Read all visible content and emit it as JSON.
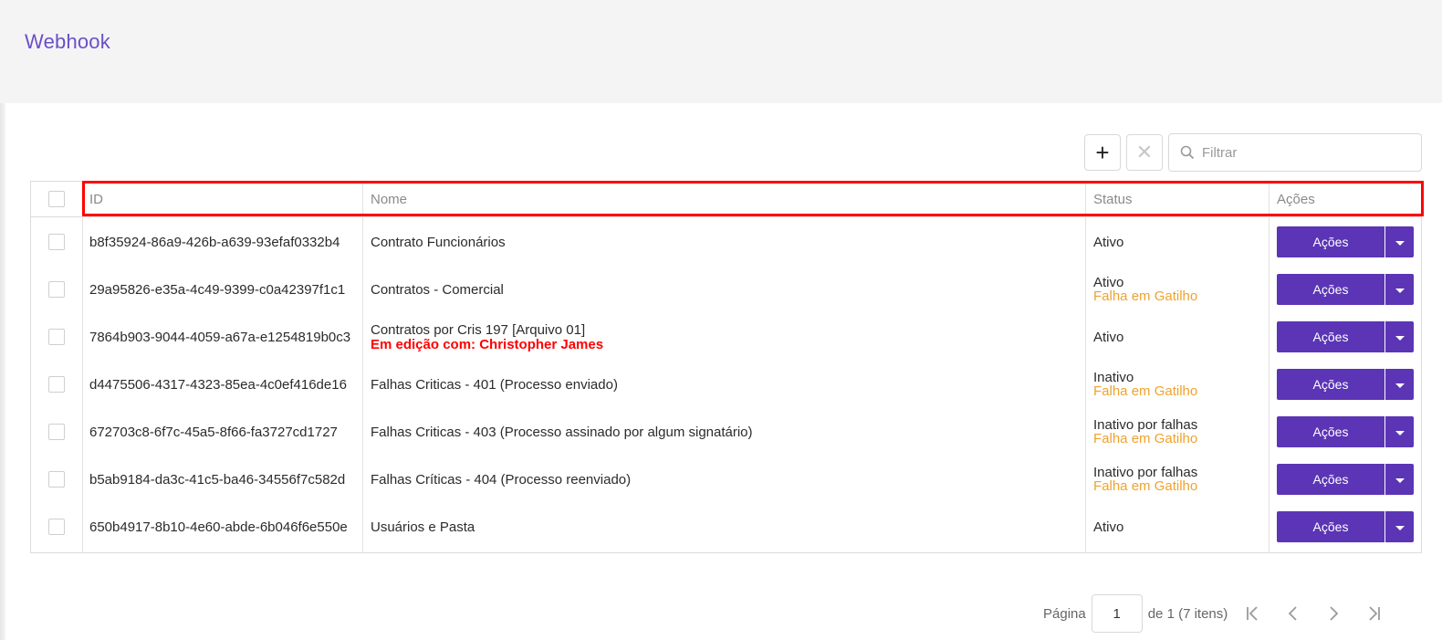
{
  "page": {
    "title": "Webhook"
  },
  "toolbar": {
    "add_icon": "+",
    "remove_icon": "✕"
  },
  "filter": {
    "placeholder": "Filtrar",
    "value": ""
  },
  "table": {
    "headers": {
      "id": "ID",
      "name": "Nome",
      "status": "Status",
      "actions": "Ações"
    },
    "rows": [
      {
        "id": "b8f35924-86a9-426b-a639-93efaf0332b4",
        "name": "Contrato Funcionários",
        "name_note": "",
        "status": "Ativo",
        "status_note": "",
        "action": "Ações"
      },
      {
        "id": "29a95826-e35a-4c49-9399-c0a42397f1c1",
        "name": "Contratos - Comercial",
        "name_note": "",
        "status": "Ativo",
        "status_note": "Falha em Gatilho",
        "action": "Ações"
      },
      {
        "id": "7864b903-9044-4059-a67a-e1254819b0c3",
        "name": "Contratos por Cris 197 [Arquivo 01]",
        "name_note": "Em edição com: Christopher James",
        "status": "Ativo",
        "status_note": "",
        "action": "Ações"
      },
      {
        "id": "d4475506-4317-4323-85ea-4c0ef416de16",
        "name": "Falhas Criticas - 401 (Processo enviado)",
        "name_note": "",
        "status": "Inativo",
        "status_note": "Falha em Gatilho",
        "action": "Ações"
      },
      {
        "id": "672703c8-6f7c-45a5-8f66-fa3727cd1727",
        "name": "Falhas Criticas - 403 (Processo assinado por algum signatário)",
        "name_note": "",
        "status": "Inativo por falhas",
        "status_note": "Falha em Gatilho",
        "action": "Ações"
      },
      {
        "id": "b5ab9184-da3c-41c5-ba46-34556f7c582d",
        "name": "Falhas Críticas - 404 (Processo reenviado)",
        "name_note": "",
        "status": "Inativo por falhas",
        "status_note": "Falha em Gatilho",
        "action": "Ações"
      },
      {
        "id": "650b4917-8b10-4e60-abde-6b046f6e550e",
        "name": "Usuários e Pasta",
        "name_note": "",
        "status": "Ativo",
        "status_note": "",
        "action": "Ações"
      }
    ]
  },
  "pagination": {
    "label": "Página",
    "current": "1",
    "summary": "de 1 (7 itens)"
  },
  "colors": {
    "brand": "#5b35b5",
    "title": "#6a4fc7",
    "warning": "#f0a22e",
    "error": "#ff0000"
  }
}
